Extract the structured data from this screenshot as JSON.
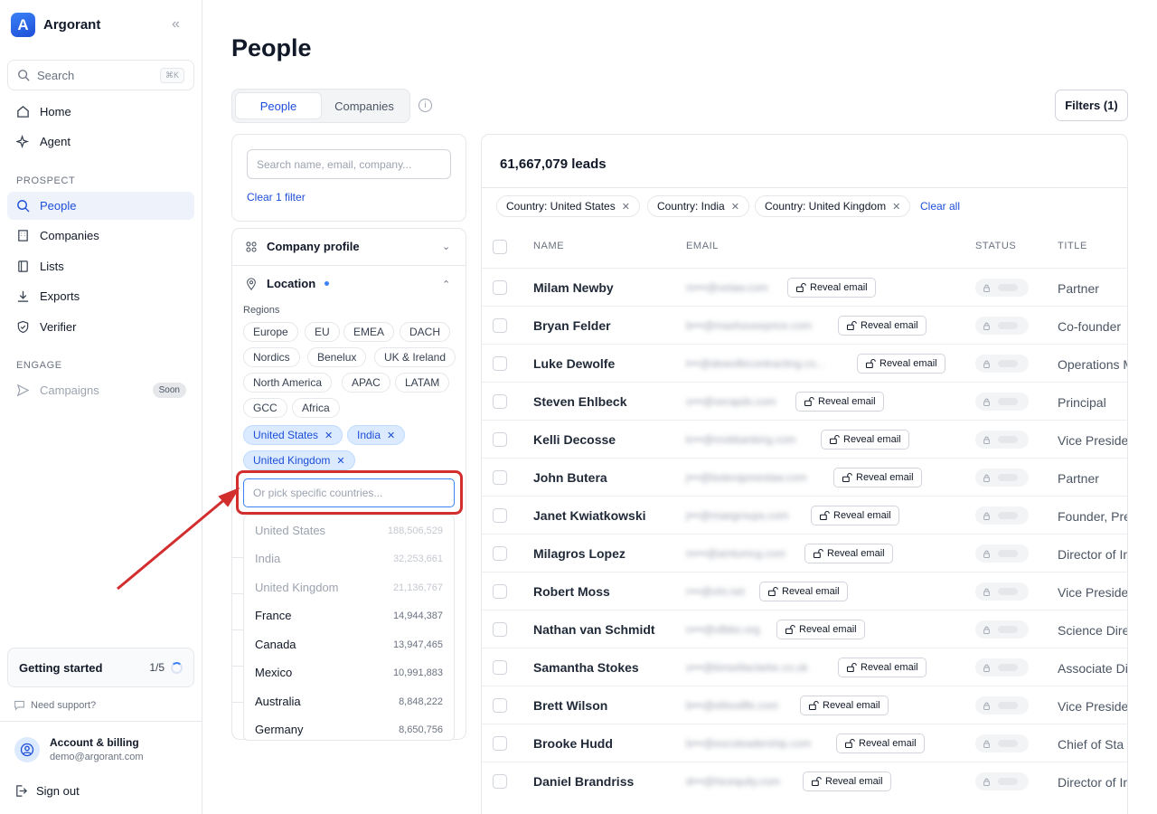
{
  "app": {
    "name": "Argorant"
  },
  "sidebar": {
    "search_label": "Search",
    "search_kbd": "⌘K",
    "home": "Home",
    "agent": "Agent",
    "prospect_section": "PROSPECT",
    "people": "People",
    "companies": "Companies",
    "lists": "Lists",
    "exports": "Exports",
    "verifier": "Verifier",
    "engage_section": "ENGAGE",
    "campaigns": "Campaigns",
    "soon_badge": "Soon",
    "getting_started": "Getting started",
    "getting_progress": "1/5",
    "support": "Need support?",
    "account_name": "Account & billing",
    "account_email": "demo@argorant.com",
    "sign_out": "Sign out"
  },
  "page": {
    "title": "People",
    "tabs": [
      "People",
      "Companies"
    ],
    "filters_button": "Filters (1)"
  },
  "filters": {
    "search_placeholder": "Search name, email, company...",
    "clear_filter": "Clear 1 filter",
    "company_profile": "Company profile",
    "location": "Location",
    "regions_label": "Regions",
    "regions": [
      "Europe",
      "EU",
      "EMEA",
      "DACH",
      "Nordics",
      "Benelux",
      "UK & Ireland",
      "North America",
      "APAC",
      "LATAM",
      "GCC",
      "Africa"
    ],
    "selected": [
      "United States",
      "India",
      "United Kingdom"
    ],
    "pick_placeholder": "Or pick specific countries...",
    "countries": [
      {
        "name": "United States",
        "count": "188,506,529"
      },
      {
        "name": "India",
        "count": "32,253,661"
      },
      {
        "name": "United Kingdom",
        "count": "21,136,767"
      },
      {
        "name": "France",
        "count": "14,944,387"
      },
      {
        "name": "Canada",
        "count": "13,947,465"
      },
      {
        "name": "Mexico",
        "count": "10,991,883"
      },
      {
        "name": "Australia",
        "count": "8,848,222"
      },
      {
        "name": "Germany",
        "count": "8,650,756"
      }
    ]
  },
  "results": {
    "leads": "61,667,079 leads",
    "active_filters": [
      "Country: United States",
      "Country: India",
      "Country: United Kingdom"
    ],
    "clear_all": "Clear all",
    "columns": [
      "NAME",
      "EMAIL",
      "STATUS",
      "TITLE"
    ],
    "reveal_label": "Reveal email",
    "rows": [
      {
        "name": "Milam Newby",
        "email": "m•••@velaw.com",
        "title": "Partner"
      },
      {
        "name": "Bryan Felder",
        "email": "b•••@maxhouseprice.com",
        "title": "Co-founder"
      },
      {
        "name": "Luke Dewolfe",
        "email": "l•••@dewolfecontracting.co...",
        "title": "Operations M"
      },
      {
        "name": "Steven Ehlbeck",
        "email": "s•••@serapdx.com",
        "title": "Principal"
      },
      {
        "name": "Kelli Decosse",
        "email": "k•••@mvbbanking.com",
        "title": "Vice Preside"
      },
      {
        "name": "John Butera",
        "email": "j•••@buterajoneslaw.com",
        "title": "Partner"
      },
      {
        "name": "Janet Kwiatkowski",
        "email": "j•••@maegroups.com",
        "title": "Founder, Pre"
      },
      {
        "name": "Milagros Lopez",
        "email": "m•••@amtumcg.com",
        "title": "Director of In"
      },
      {
        "name": "Robert Moss",
        "email": "r•••@ohi.net",
        "title": "Vice Preside"
      },
      {
        "name": "Nathan van Schmidt",
        "email": "n•••@sfbbo.org",
        "title": "Science Dire"
      },
      {
        "name": "Samantha Stokes",
        "email": "s•••@kinsellaclarke.co.uk",
        "title": "Associate Di"
      },
      {
        "name": "Brett Wilson",
        "email": "b•••@ethosllfe.com",
        "title": "Vice Preside"
      },
      {
        "name": "Brooke Hudd",
        "email": "b•••@excoleadership.com",
        "title": "Chief of Sta"
      },
      {
        "name": "Daniel Brandriss",
        "email": "d•••@hicequity.com",
        "title": "Director of In"
      }
    ]
  },
  "colors": {
    "accent": "#1d4ed8",
    "highlight": "#d22e2e"
  }
}
